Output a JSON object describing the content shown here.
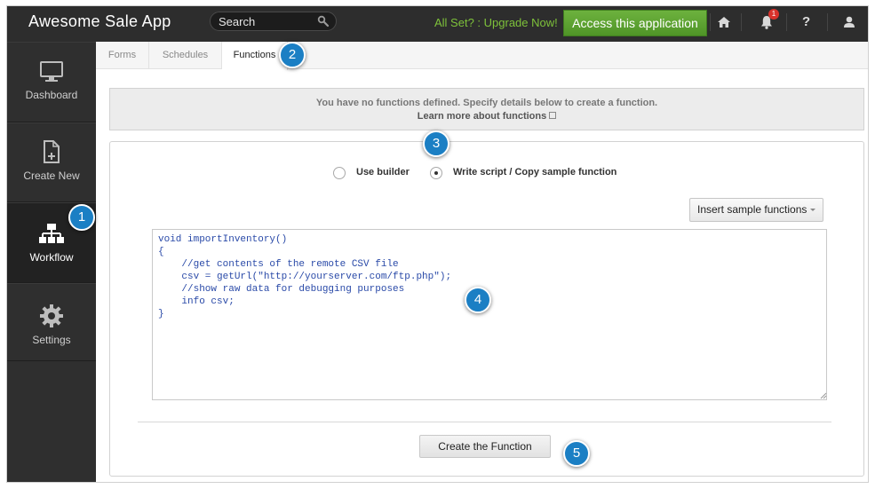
{
  "header": {
    "app_title": "Awesome Sale App",
    "search_placeholder": "Search",
    "upgrade_link": "All Set? : Upgrade Now!",
    "access_button": "Access this application",
    "notification_count": "1",
    "help_label": "?",
    "icons": [
      "home-icon",
      "bell-icon",
      "help-icon",
      "user-icon"
    ]
  },
  "sidebar": {
    "items": [
      {
        "label": "Dashboard",
        "icon": "monitor-icon",
        "active": false
      },
      {
        "label": "Create New",
        "icon": "new-document-icon",
        "active": false
      },
      {
        "label": "Workflow",
        "icon": "workflow-icon",
        "active": true
      },
      {
        "label": "Settings",
        "icon": "gear-icon",
        "active": false
      }
    ]
  },
  "tabs": [
    {
      "label": "Forms",
      "active": false
    },
    {
      "label": "Schedules",
      "active": false
    },
    {
      "label": "Functions",
      "active": true
    }
  ],
  "info": {
    "message": "You have no functions defined. Specify details below to create a function.",
    "link": "Learn more about functions"
  },
  "editor": {
    "options": [
      {
        "label": "Use builder",
        "checked": false
      },
      {
        "label": "Write script / Copy sample function",
        "checked": true
      }
    ],
    "sample_button": "Insert sample functions",
    "code": "void importInventory()\n{\n    //get contents of the remote CSV file\n    csv = getUrl(\"http://yourserver.com/ftp.php\");\n    //show raw data for debugging purposes\n    info csv;\n}",
    "create_button": "Create the Function"
  },
  "callouts": [
    "1",
    "2",
    "3",
    "4",
    "5"
  ],
  "colors": {
    "topbar": "#2d2d2d",
    "sidebar": "#2f2f2f",
    "accent_green": "#4f9427",
    "upgrade_green": "#7ec23a",
    "callout_blue": "#1b7fc4",
    "code_blue": "#2a4aa8"
  }
}
